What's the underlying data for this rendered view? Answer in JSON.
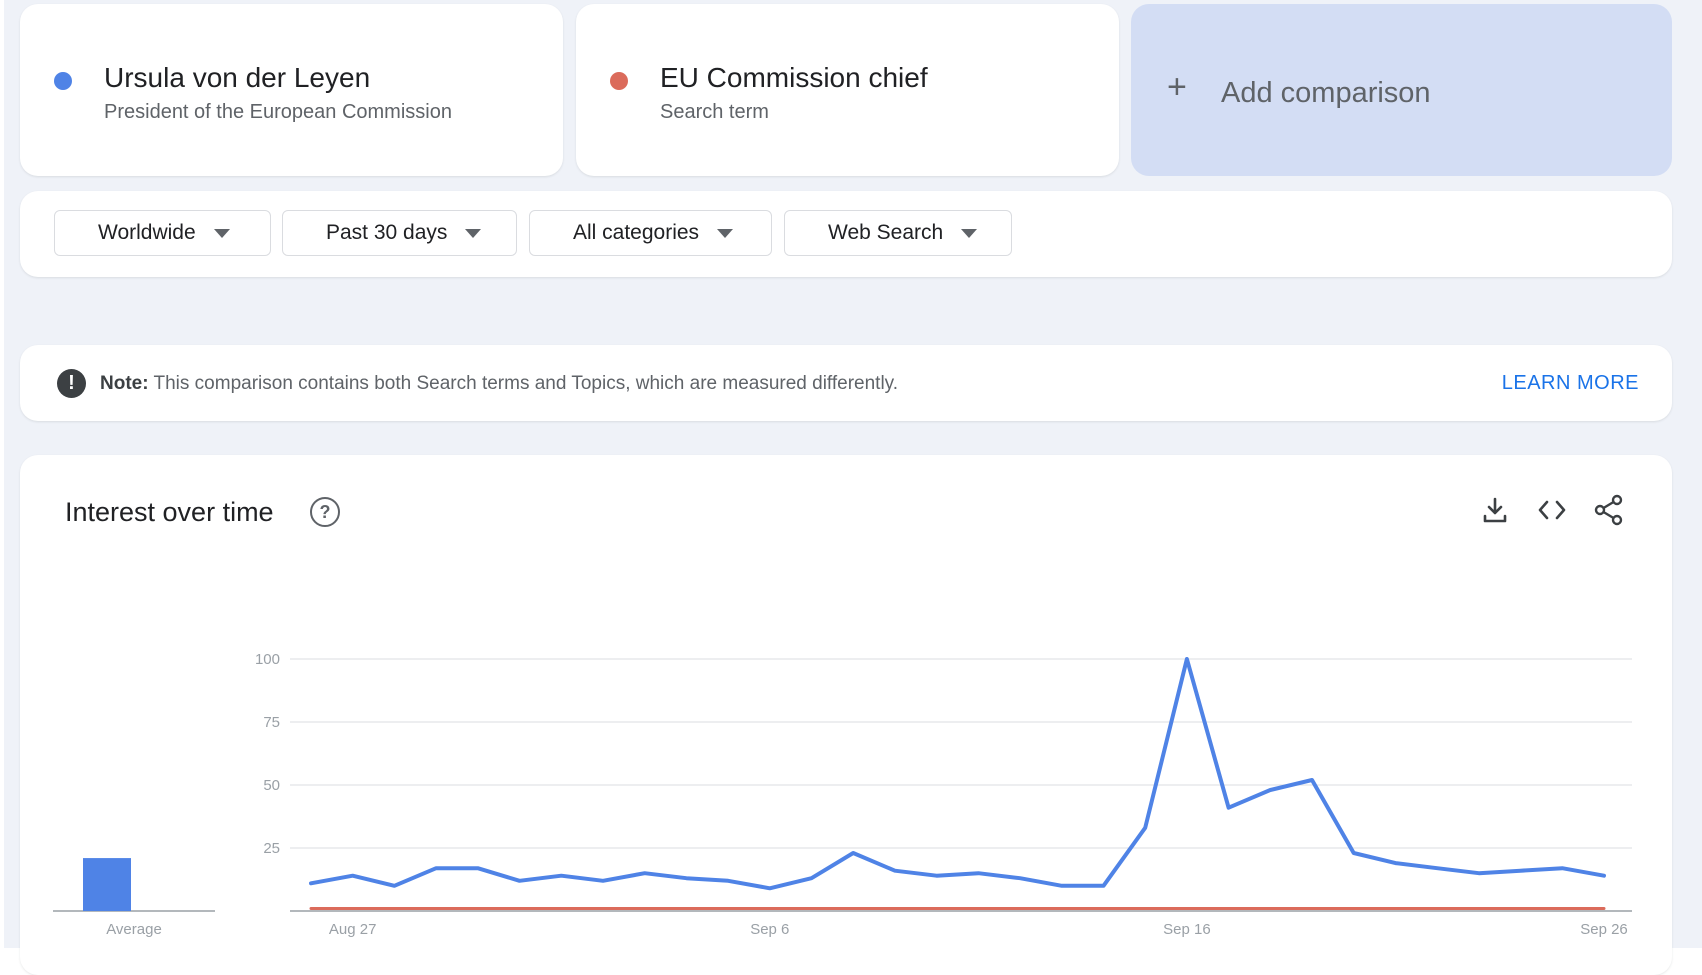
{
  "terms": [
    {
      "name": "Ursula von der Leyen",
      "subtitle": "President of the European Commission",
      "color": "#4f83e6"
    },
    {
      "name": "EU Commission chief",
      "subtitle": "Search term",
      "color": "#db6b5b"
    }
  ],
  "add_comparison": {
    "icon": "plus-icon",
    "label": "Add comparison"
  },
  "filters": [
    {
      "label": "Worldwide",
      "icon": "caret-down-icon"
    },
    {
      "label": "Past 30 days",
      "icon": "caret-down-icon"
    },
    {
      "label": "All categories",
      "icon": "caret-down-icon"
    },
    {
      "label": "Web Search",
      "icon": "caret-down-icon"
    }
  ],
  "note": {
    "icon": "exclamation-icon",
    "bold": "Note:",
    "text": " This comparison contains both Search terms and Topics, which are measured differently.",
    "link": "LEARN MORE"
  },
  "chart_panel": {
    "title": "Interest over time",
    "icons": [
      "help-icon",
      "download-icon",
      "embed-icon",
      "share-icon"
    ]
  },
  "chart_data": {
    "type": "line",
    "average": {
      "label": "Average",
      "values": [
        21,
        0
      ]
    },
    "x_labels": [
      "Aug 27",
      "Sep 6",
      "Sep 16",
      "Sep 26"
    ],
    "x_label_index": [
      1,
      11,
      21,
      31
    ],
    "y_ticks": [
      "100",
      "75",
      "50",
      "25"
    ],
    "ylim": [
      0,
      100
    ],
    "series": [
      {
        "color": "#4f83e6",
        "values": [
          11,
          14,
          10,
          17,
          17,
          12,
          14,
          12,
          15,
          13,
          12,
          9,
          13,
          23,
          16,
          14,
          15,
          13,
          10,
          10,
          33,
          100,
          41,
          48,
          52,
          23,
          19,
          17,
          15,
          16,
          17,
          14
        ]
      },
      {
        "color": "#db6b5b",
        "values": [
          1,
          1,
          1,
          1,
          1,
          1,
          1,
          1,
          1,
          1,
          1,
          1,
          1,
          1,
          1,
          1,
          1,
          1,
          1,
          1,
          1,
          1,
          1,
          1,
          1,
          1,
          1,
          1,
          1,
          1,
          1,
          1
        ]
      }
    ]
  }
}
